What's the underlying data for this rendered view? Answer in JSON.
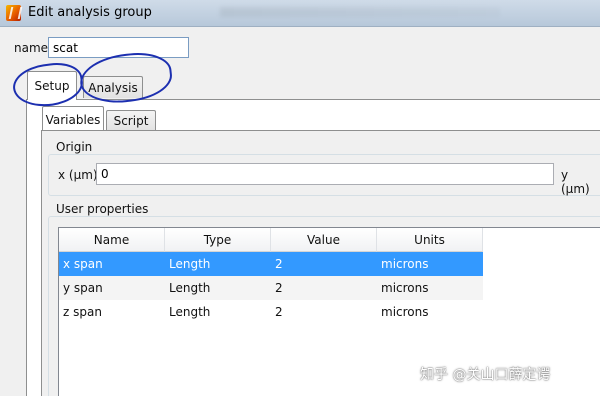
{
  "window": {
    "title": "Edit analysis group"
  },
  "name_field": {
    "label": "name",
    "value": "scat"
  },
  "tabs": [
    {
      "label": "Setup"
    },
    {
      "label": "Analysis"
    }
  ],
  "subtabs": [
    {
      "label": "Variables"
    },
    {
      "label": "Script"
    }
  ],
  "origin": {
    "title": "Origin",
    "x_label": "x (μm)",
    "x_value": "0",
    "y_label": "y (μm)"
  },
  "user_properties": {
    "title": "User properties",
    "columns": [
      "Name",
      "Type",
      "Value",
      "Units"
    ],
    "rows": [
      [
        "x span",
        "Length",
        "2",
        "microns"
      ],
      [
        "y span",
        "Length",
        "2",
        "microns"
      ],
      [
        "z span",
        "Length",
        "2",
        "microns"
      ]
    ]
  },
  "watermark": "知乎 @关山口薛定谔",
  "colors": {
    "selection": "#3399ff",
    "annotation": "#1c2fb0"
  },
  "icons": {
    "app": "app-logo-icon"
  }
}
